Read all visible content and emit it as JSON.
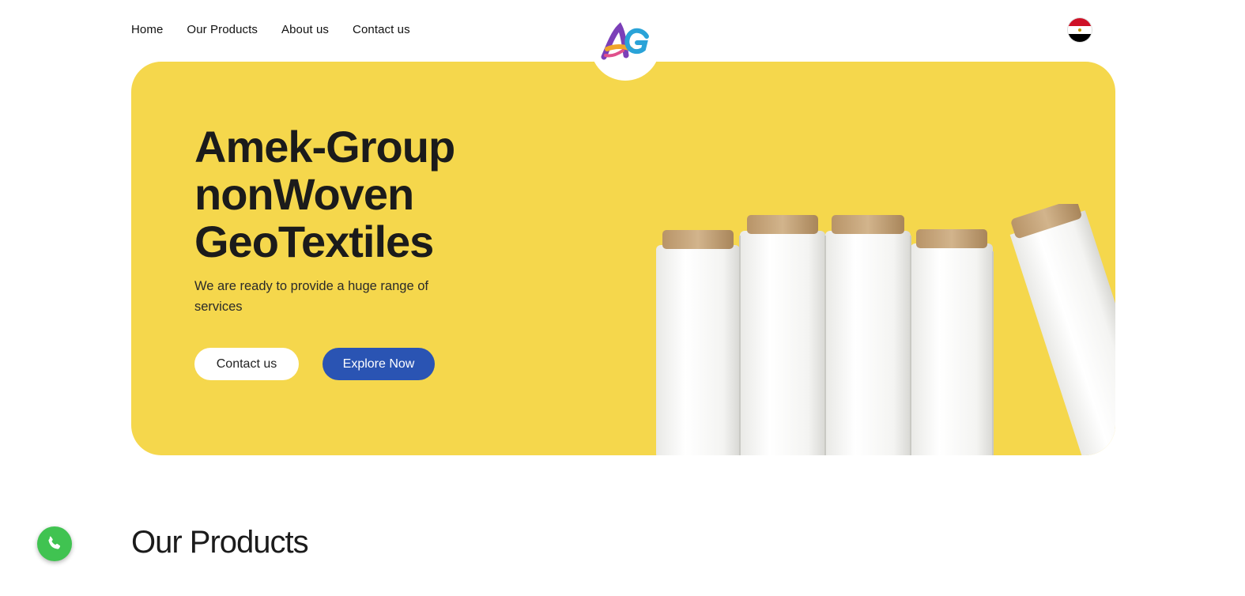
{
  "nav": {
    "items": [
      {
        "label": "Home"
      },
      {
        "label": "Our Products"
      },
      {
        "label": "About us"
      },
      {
        "label": "Contact us"
      }
    ]
  },
  "logo": {
    "icon": "ag-logo-icon"
  },
  "language": {
    "icon": "egypt-flag-icon",
    "colors": [
      "#ce1126",
      "#ffffff",
      "#000000"
    ]
  },
  "hero": {
    "title_lines": [
      "Amek-Group",
      "nonWoven",
      "GeoTextiles"
    ],
    "subtitle": "We are ready to provide a huge range of services",
    "contact_button": "Contact us",
    "explore_button": "Explore Now",
    "background": "#f5d74c",
    "accent": "#2a54b3"
  },
  "products": {
    "title": "Our Products"
  },
  "whatsapp": {
    "icon": "whatsapp-icon",
    "color": "#40c351"
  }
}
